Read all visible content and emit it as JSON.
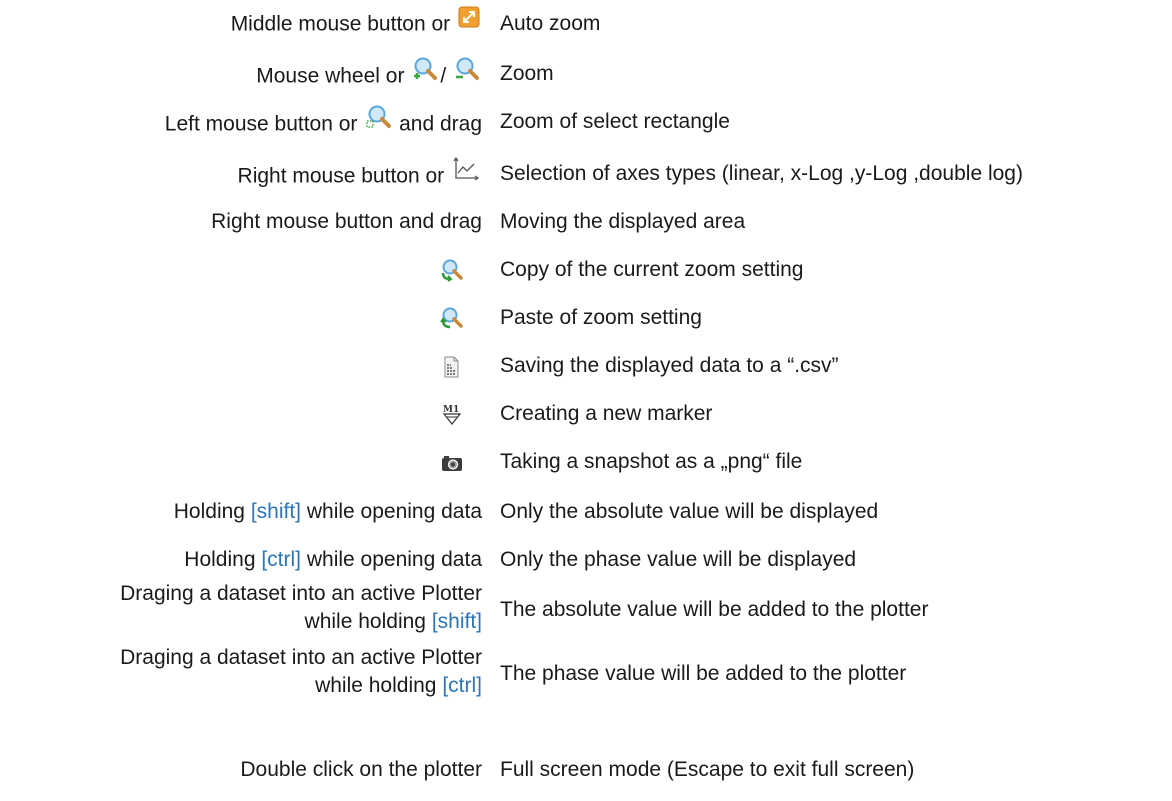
{
  "rows": {
    "auto_zoom": {
      "left_pre": "Middle mouse button or",
      "right": "Auto zoom"
    },
    "zoom": {
      "left_pre": "Mouse wheel or",
      "left_sep": "/",
      "right": "Zoom"
    },
    "rect_zoom": {
      "left_pre": "Left mouse button or",
      "left_post": "and drag",
      "right": "Zoom of select rectangle"
    },
    "axes": {
      "left_pre": "Right mouse button or",
      "right": "Selection of axes types (linear, x-Log ,y-Log ,double log)"
    },
    "move": {
      "left": "Right mouse button and drag",
      "right": "Moving the displayed area"
    },
    "copy_zoom": {
      "right": "Copy of the current zoom setting"
    },
    "paste_zoom": {
      "right": "Paste of zoom setting"
    },
    "save_csv": {
      "right": "Saving the displayed data to a “.csv”"
    },
    "marker": {
      "right": "Creating a new marker"
    },
    "snapshot": {
      "right": "Taking a snapshot as a „png“ file"
    },
    "shift_open": {
      "left_pre": "Holding",
      "key": "[shift]",
      "left_post": "while opening data",
      "right": "Only the absolute value will be displayed"
    },
    "ctrl_open": {
      "left_pre": "Holding",
      "key": "[ctrl]",
      "left_post": "while opening data",
      "right": "Only the phase value will be displayed"
    },
    "shift_drag": {
      "left_line1": "Draging a dataset into an active Plotter",
      "left_line2_pre": "while holding",
      "key": "[shift]",
      "right": "The absolute value will be added to the plotter"
    },
    "ctrl_drag": {
      "left_line1": "Draging a dataset into an active Plotter",
      "left_line2_pre": "while holding",
      "key": "[ctrl]",
      "right": "The phase value will be added to the plotter"
    },
    "fullscreen": {
      "left": "Double click on the plotter",
      "right": "Full screen mode (Escape to exit full  screen)"
    }
  },
  "icons": {
    "auto_zoom": "auto-zoom-icon",
    "zoom_in": "zoom-in-icon",
    "zoom_out": "zoom-out-icon",
    "rect_zoom": "zoom-rectangle-icon",
    "axes": "axes-type-icon",
    "copy_zoom": "copy-zoom-icon",
    "paste_zoom": "paste-zoom-icon",
    "save_csv": "csv-file-icon",
    "marker": "marker-m1-icon",
    "snapshot": "camera-icon"
  },
  "colors": {
    "key_highlight": "#2e75b6",
    "auto_zoom_orange": "#f0a030",
    "magnifier_blue": "#8fc8ef",
    "zoom_green": "#3aa83a"
  }
}
